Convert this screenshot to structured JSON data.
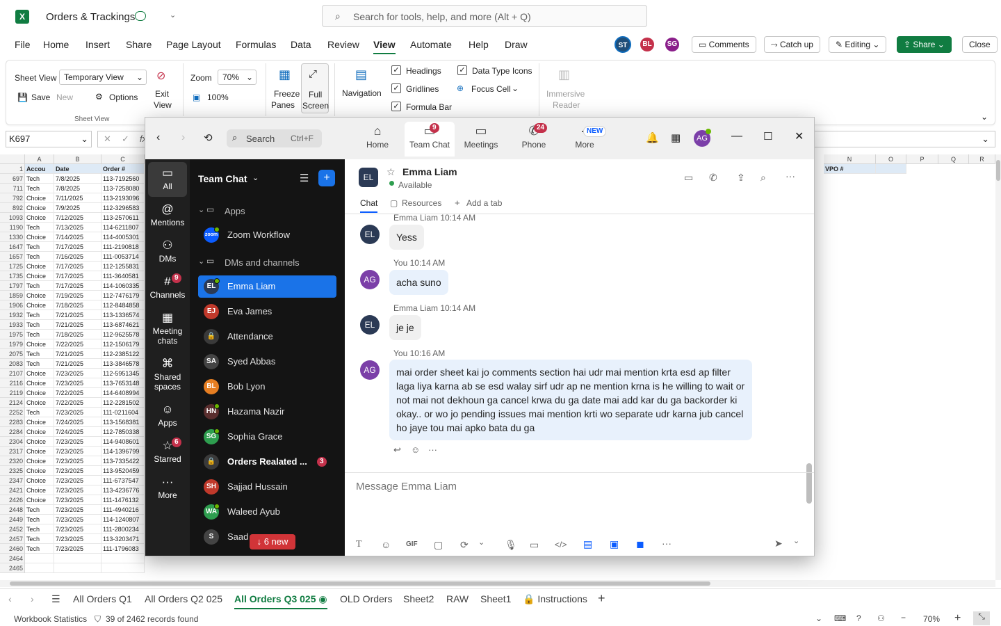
{
  "excel": {
    "title": "Orders & Trackings",
    "search_placeholder": "Search for tools, help, and more (Alt + Q)",
    "menu": [
      "File",
      "Home",
      "Insert",
      "Share",
      "Page Layout",
      "Formulas",
      "Data",
      "Review",
      "View",
      "Automate",
      "Help",
      "Draw"
    ],
    "active_menu": "View",
    "avatars": [
      {
        "initials": "ST",
        "color": "#1f4e79"
      },
      {
        "initials": "BL",
        "color": "#c4314b"
      },
      {
        "initials": "SG",
        "color": "#8a1e8a"
      }
    ],
    "buttons": {
      "comments": "Comments",
      "catch_up": "Catch up",
      "editing": "Editing",
      "share": "Share",
      "close": "Close"
    },
    "ribbon": {
      "sheet_view_label": "Sheet View",
      "sheet_view_value": "Temporary View",
      "save": "Save",
      "new": "New",
      "options": "Options",
      "exit_view_1": "Exit",
      "exit_view_2": "View",
      "group_sheet_view": "Sheet View",
      "zoom_label": "Zoom",
      "zoom_value": "70%",
      "zoom_100": "100%",
      "freeze_1": "Freeze",
      "freeze_2": "Panes",
      "full_1": "Full",
      "full_2": "Screen",
      "navigation": "Navigation",
      "headings": "Headings",
      "gridlines": "Gridlines",
      "formula_bar": "Formula Bar",
      "data_type_icons": "Data Type Icons",
      "focus_cell": "Focus Cell",
      "immersive_1": "Immersive",
      "immersive_2": "Reader"
    },
    "name_box": "K697",
    "columns": [
      "A",
      "B",
      "C"
    ],
    "right_columns": [
      "N",
      "O",
      "P",
      "Q",
      "R"
    ],
    "headers": {
      "a": "Accou",
      "b": "Date",
      "c": "Order #",
      "n": "VPO #"
    },
    "rows": [
      [
        "697",
        "Tech",
        "7/8/2025",
        "113-7192560"
      ],
      [
        "711",
        "Tech",
        "7/8/2025",
        "113-7258080"
      ],
      [
        "792",
        "Choice",
        "7/11/2025",
        "113-2193096"
      ],
      [
        "892",
        "Choice",
        "7/9/2025",
        "112-3296583"
      ],
      [
        "1093",
        "Choice",
        "7/12/2025",
        "113-2570611"
      ],
      [
        "1190",
        "Tech",
        "7/13/2025",
        "114-6211807"
      ],
      [
        "1330",
        "Choice",
        "7/14/2025",
        "114-4005301"
      ],
      [
        "1647",
        "Tech",
        "7/17/2025",
        "111-2190818"
      ],
      [
        "1657",
        "Tech",
        "7/16/2025",
        "111-0053714"
      ],
      [
        "1725",
        "Choice",
        "7/17/2025",
        "112-1255831"
      ],
      [
        "1735",
        "Choice",
        "7/17/2025",
        "111-3640581"
      ],
      [
        "1797",
        "Tech",
        "7/17/2025",
        "114-1060335"
      ],
      [
        "1859",
        "Choice",
        "7/19/2025",
        "112-7476179"
      ],
      [
        "1906",
        "Choice",
        "7/18/2025",
        "112-8484858"
      ],
      [
        "1932",
        "Tech",
        "7/21/2025",
        "113-1336574"
      ],
      [
        "1933",
        "Tech",
        "7/21/2025",
        "113-6874621"
      ],
      [
        "1975",
        "Tech",
        "7/18/2025",
        "112-9625578"
      ],
      [
        "1979",
        "Choice",
        "7/22/2025",
        "112-1506179"
      ],
      [
        "2075",
        "Tech",
        "7/21/2025",
        "112-2385122"
      ],
      [
        "2083",
        "Tech",
        "7/21/2025",
        "113-3846578"
      ],
      [
        "2107",
        "Choice",
        "7/23/2025",
        "112-5951345"
      ],
      [
        "2116",
        "Choice",
        "7/23/2025",
        "113-7653148"
      ],
      [
        "2119",
        "Choice",
        "7/22/2025",
        "114-6408994"
      ],
      [
        "2124",
        "Choice",
        "7/22/2025",
        "112-2281502"
      ],
      [
        "2252",
        "Tech",
        "7/23/2025",
        "111-0211604"
      ],
      [
        "2283",
        "Choice",
        "7/24/2025",
        "113-1568381"
      ],
      [
        "2284",
        "Choice",
        "7/24/2025",
        "112-7850338"
      ],
      [
        "2304",
        "Choice",
        "7/23/2025",
        "114-9408601"
      ],
      [
        "2317",
        "Choice",
        "7/23/2025",
        "114-1396799"
      ],
      [
        "2320",
        "Choice",
        "7/23/2025",
        "113-7335422"
      ],
      [
        "2325",
        "Choice",
        "7/23/2025",
        "113-9520459"
      ],
      [
        "2347",
        "Choice",
        "7/23/2025",
        "111-6737547"
      ],
      [
        "2421",
        "Choice",
        "7/23/2025",
        "113-4236776"
      ],
      [
        "2426",
        "Choice",
        "7/23/2025",
        "111-1476132"
      ],
      [
        "2448",
        "Tech",
        "7/23/2025",
        "111-4940216"
      ],
      [
        "2449",
        "Tech",
        "7/23/2025",
        "114-1240807"
      ],
      [
        "2452",
        "Tech",
        "7/23/2025",
        "111-2800234"
      ],
      [
        "2457",
        "Tech",
        "7/23/2025",
        "113-3203471"
      ],
      [
        "2460",
        "Tech",
        "7/23/2025",
        "111-1796083"
      ],
      [
        "2464",
        "",
        "",
        ""
      ],
      [
        "2465",
        "",
        "",
        ""
      ]
    ],
    "sheet_tabs": [
      "All Orders Q1",
      "All Orders Q2 025",
      "All Orders Q3 025",
      "OLD Orders",
      "Sheet2",
      "RAW",
      "Sheet1",
      "Instructions"
    ],
    "active_tab": "All Orders Q3 025",
    "status_left": "Workbook Statistics",
    "status_filter": "39 of 2462 records found",
    "zoom_status": "70%"
  },
  "teams": {
    "search": "Search",
    "search_shortcut": "Ctrl+F",
    "nav": [
      {
        "label": "Home",
        "icon": "⌂",
        "badge": ""
      },
      {
        "label": "Team Chat",
        "icon": "💬",
        "badge": "9"
      },
      {
        "label": "Meetings",
        "icon": "▭",
        "badge": ""
      },
      {
        "label": "Phone",
        "icon": "✆",
        "badge": "24"
      },
      {
        "label": "More",
        "icon": "···",
        "badge": "NEW"
      }
    ],
    "user_initials": "AG",
    "rail": [
      {
        "label": "All",
        "icon": "💬",
        "badge": ""
      },
      {
        "label": "Mentions",
        "icon": "@",
        "badge": ""
      },
      {
        "label": "DMs",
        "icon": "👥",
        "badge": ""
      },
      {
        "label": "Channels",
        "icon": "#",
        "badge": "9"
      },
      {
        "label": "Meeting chats",
        "icon": "📅",
        "badge": ""
      },
      {
        "label": "Shared spaces",
        "icon": "⌘",
        "badge": ""
      },
      {
        "label": "Apps",
        "icon": "☺",
        "badge": ""
      },
      {
        "label": "Starred",
        "icon": "☆",
        "badge": "6"
      },
      {
        "label": "More",
        "icon": "···",
        "badge": ""
      }
    ],
    "list_title": "Team Chat",
    "section_apps": "Apps",
    "section_dms": "DMs and channels",
    "apps": [
      {
        "name": "Zoom Workflow",
        "initials": "zoom",
        "color": "#0b5cff"
      }
    ],
    "contacts": [
      {
        "name": "Emma Liam",
        "initials": "EL",
        "color": "#2b3a55",
        "online": true,
        "selected": true,
        "bold": false,
        "badge": ""
      },
      {
        "name": "Eva James",
        "initials": "EJ",
        "color": "#c0392b",
        "online": false,
        "selected": false,
        "bold": false,
        "badge": ""
      },
      {
        "name": "Attendance",
        "initials": "🔒",
        "color": "#3a3a3a",
        "online": false,
        "selected": false,
        "bold": false,
        "badge": ""
      },
      {
        "name": "Syed Abbas",
        "initials": "SA",
        "color": "#444",
        "online": false,
        "selected": false,
        "bold": false,
        "badge": ""
      },
      {
        "name": "Bob Lyon",
        "initials": "BL",
        "color": "#e67e22",
        "online": false,
        "selected": false,
        "bold": false,
        "badge": ""
      },
      {
        "name": "Hazama Nazir",
        "initials": "HN",
        "color": "#5a2e2e",
        "online": true,
        "selected": false,
        "bold": false,
        "badge": ""
      },
      {
        "name": "Sophia Grace",
        "initials": "SG",
        "color": "#2e9e4f",
        "online": true,
        "selected": false,
        "bold": false,
        "badge": ""
      },
      {
        "name": "Orders Realated ...",
        "initials": "🔒",
        "color": "#3a3a3a",
        "online": false,
        "selected": false,
        "bold": true,
        "badge": "3"
      },
      {
        "name": "Sajjad Hussain",
        "initials": "SH",
        "color": "#c0392b",
        "online": false,
        "selected": false,
        "bold": false,
        "badge": ""
      },
      {
        "name": "Waleed Ayub",
        "initials": "WA",
        "color": "#2e9e4f",
        "online": true,
        "selected": false,
        "bold": false,
        "badge": ""
      },
      {
        "name": "Saad",
        "initials": "S",
        "color": "#444",
        "online": false,
        "selected": false,
        "bold": false,
        "badge": ""
      }
    ],
    "new_pill": "↓ 6 new",
    "chat": {
      "name": "Emma Liam",
      "initials": "EL",
      "status": "Available",
      "tabs": [
        "Chat",
        "Resources",
        "Add a tab"
      ],
      "messages": [
        {
          "who": "Emma Liam",
          "time": "10:14 AM",
          "text": "Yess",
          "initials": "EL",
          "me": false
        },
        {
          "who": "You",
          "time": "10:14 AM",
          "text": "acha suno",
          "initials": "AG",
          "me": true
        },
        {
          "who": "Emma Liam",
          "time": "10:14 AM",
          "text": "je je",
          "initials": "EL",
          "me": false
        },
        {
          "who": "You",
          "time": "10:16 AM",
          "text": "mai order sheet kai jo comments section hai udr mai mention krta esd ap filter laga liya karna ab se esd walay sirf udr ap ne mention krna is he willing to wait or not mai not dekhoun ga cancel krwa du ga date mai add kar du ga backorder ki okay.. or wo jo pending issues mai mention krti wo separate udr karna jub cancel ho jaye tou mai apko bata du ga",
          "initials": "AG",
          "me": true
        }
      ],
      "composer_placeholder": "Message Emma Liam",
      "toolbar": [
        "T",
        "☺",
        "GIF",
        "▢",
        "⟳",
        "⌄",
        "🎙",
        "▭",
        "</>",
        "▤",
        "▣",
        "◼",
        "···"
      ]
    }
  }
}
